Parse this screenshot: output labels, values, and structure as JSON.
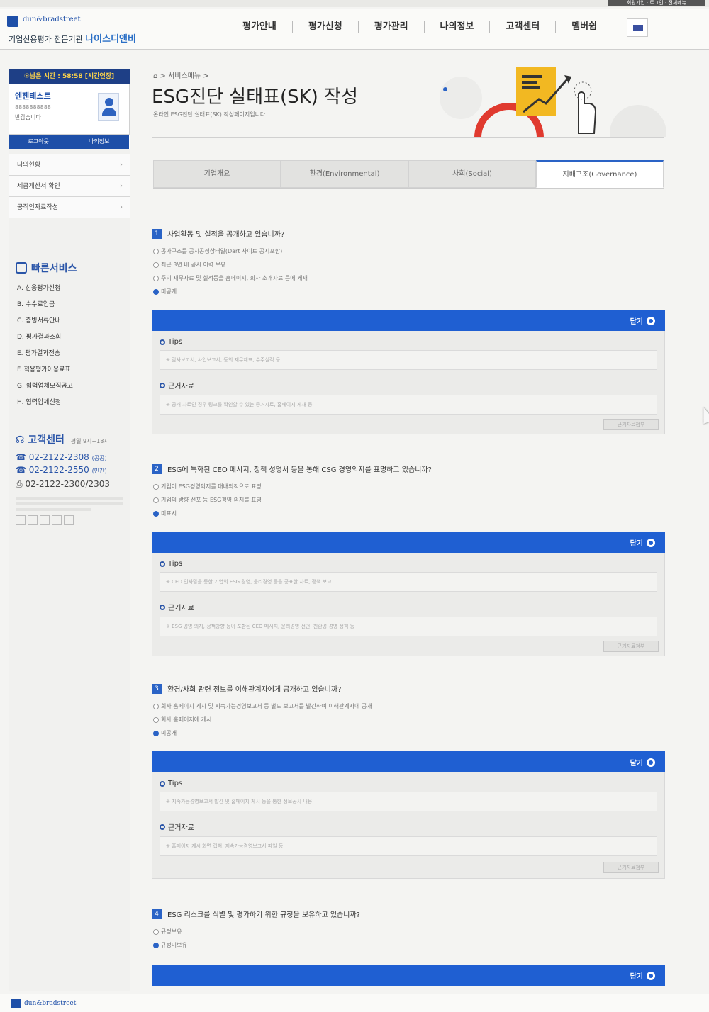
{
  "topbar": {
    "right_label": "회원가입 · 로그인 · 전체메뉴"
  },
  "header": {
    "logo_top": "dun&bradstreet",
    "logo_sub": "기업신용평가 전문기관",
    "logo_brand": "나이스디앤비",
    "nav": [
      "평가안내",
      "평가신청",
      "평가관리",
      "나의정보",
      "고객센터",
      "멤버쉽"
    ]
  },
  "sidebar": {
    "session": "☉남은 시간 : 58:58 [시간연장]",
    "user_name": "엔젠테스트",
    "user_id": "8888888888",
    "user_greet": "반갑습니다",
    "logout": "로그아웃",
    "myinfo": "나의정보",
    "menu": [
      "나의현황",
      "세금계산서 확인",
      "공직인자료작성"
    ],
    "quick_title": "빠른서비스",
    "quick_items": [
      "A. 신용평가신청",
      "B. 수수료입금",
      "C. 증빙서류안내",
      "D. 평가결과조회",
      "E. 평가결과전송",
      "F. 적용평가이용료표",
      "G. 협력업체모집공고",
      "H. 협력업체신청"
    ],
    "cs_title": "고객센터",
    "cs_hours": "평일 9시~18시",
    "cs_phone1": "02-2122-2308",
    "cs_phone1_tag": "(공공)",
    "cs_phone2": "02-2122-2550",
    "cs_phone2_tag": "(민간)",
    "cs_fax": "02-2122-2300/2303"
  },
  "main": {
    "breadcrumb": "⌂ > 서비스메뉴 >",
    "title": "ESG진단 실태표(SK) 작성",
    "desc": "온라인 ESG진단 실태표(SK) 작성페이지입니다.",
    "tabs": [
      "기업개요",
      "환경(Environmental)",
      "사회(Social)",
      "지배구조(Governance)"
    ]
  },
  "questions": [
    {
      "num": "1",
      "title": "사업활동 및 실적을 공개하고 있습니까?",
      "options": [
        "공가구조를 공시공정상태일(Dart 사이트 공시포함)",
        "최근 3년 내 공시 이력 보유",
        "주의 재무자료 및 실적등을 홈페이지, 회사 소개자료 등에 게재",
        "미공개"
      ],
      "checked": 3,
      "close_label": "닫기",
      "tips_label": "Tips",
      "tips_text": "※ 감사보고서, 사업보고서, 등의 재무제표, 수주실적 등",
      "ref_label": "근거자료",
      "ref_text": "※ 공개 자료인 경우 링크를 확인할 수 있는 증거자료, 홈페이지 게재 등",
      "btn_label": "근거자료첨부"
    },
    {
      "num": "2",
      "title": "ESG에 특화된 CEO 메시지, 정책 성명서 등을 통해 CSG 경영의지를 표명하고 있습니까?",
      "options": [
        "기업이 ESG경영의지를 대내외적으로 표명",
        "기업의 방향 선포 등 ESG경영 의지를 표명",
        "미표시"
      ],
      "checked": 2,
      "close_label": "닫기",
      "tips_label": "Tips",
      "tips_text": "※ CEO 인사말을 통한 기업의 ESG 경영, 윤리경영 등을 공표한 자료, 정책 보고",
      "ref_label": "근거자료",
      "ref_text": "※ ESG 경영 의지, 정책방향 등이 포함된 CEO 메시지, 윤리경영 선언, 친환경 경영 정책 등",
      "btn_label": "근거자료첨부"
    },
    {
      "num": "3",
      "title": "환경/사회 관련 정보를 이해관계자에게 공개하고 있습니까?",
      "options": [
        "회사 홈페이지 게시 및 지속가능경영보고서 등 별도 보고서를 발간하여 이해관계자에 공개",
        "회사 홈페이지에 게시",
        "미공개"
      ],
      "checked": 2,
      "close_label": "닫기",
      "tips_label": "Tips",
      "tips_text": "※ 지속가능경영보고서 발간 및 홈페이지 게시 등을 통한 정보공시 내용",
      "ref_label": "근거자료",
      "ref_text": "※ 홈페이지 게시 화면 캡처, 지속가능경영보고서 파일 등",
      "btn_label": "근거자료첨부"
    },
    {
      "num": "4",
      "title": "ESG 리스크를 식별 및 평가하기 위한 규정을 보유하고 있습니까?",
      "options": [
        "규정보유",
        "규정미보유"
      ],
      "checked": 1,
      "close_label": "닫기"
    }
  ],
  "footer": {
    "logo": "dun&bradstreet"
  },
  "colors": {
    "accent": "#1f5fd2",
    "navy": "#1e3f86",
    "session_text": "#ffd54a"
  },
  "icons": [
    "home-icon",
    "close-icon",
    "phone-icon",
    "fax-icon",
    "headset-icon",
    "quick-service-icon",
    "user-avatar-icon",
    "flag-icon"
  ]
}
